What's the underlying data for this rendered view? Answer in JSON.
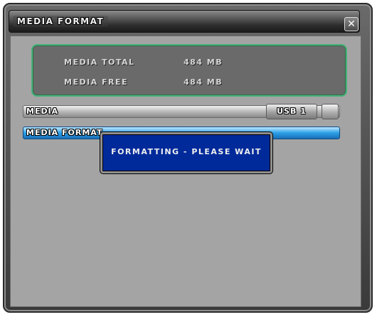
{
  "window": {
    "title": "MEDIA FORMAT",
    "close_glyph": "✕"
  },
  "info": {
    "total_label": "MEDIA TOTAL",
    "total_value": "484 MB",
    "free_label": "MEDIA FREE",
    "free_value": "484 MB"
  },
  "media_row": {
    "label": "MEDIA",
    "selected_device": "USB 1"
  },
  "format_row": {
    "label": "MEDIA FORMAT"
  },
  "popup": {
    "message": "FORMATTING - PLEASE WAIT"
  },
  "colors": {
    "panel_border": "#48b27a",
    "highlight": "#2a9fe6",
    "popup_bg": "#002a9a"
  }
}
